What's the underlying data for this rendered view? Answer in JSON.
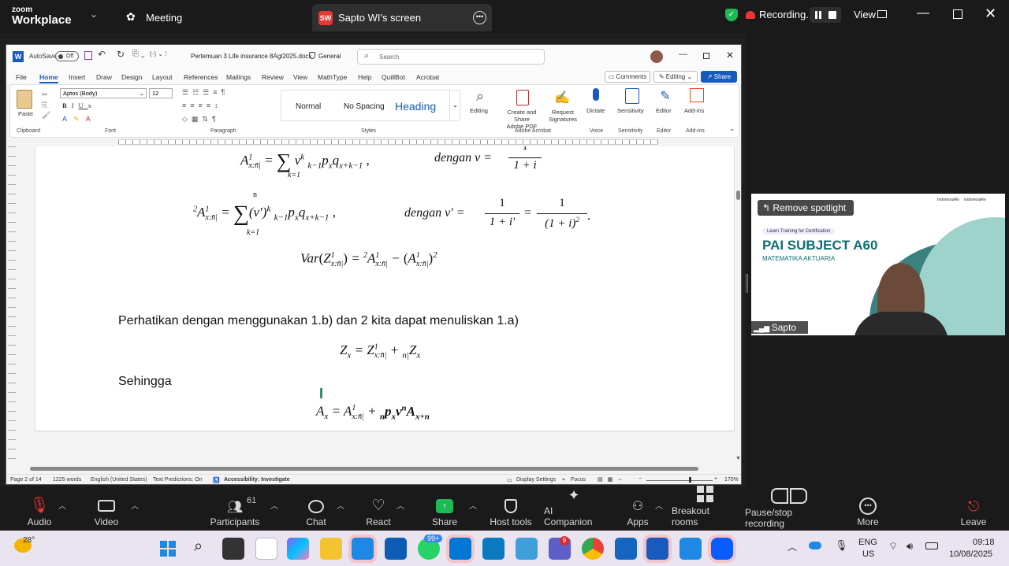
{
  "zoom": {
    "brand_top": "zoom",
    "brand_bottom": "Workplace",
    "meeting_tab": "Meeting",
    "share_tab_badge": "SW",
    "share_tab": "Sapto WI's screen",
    "recording": "Recording...",
    "view": "View"
  },
  "word": {
    "autosave": "AutoSave",
    "autosave_state": "Off",
    "filename": "Pertemuan 3 Life insurance 8Agt2025.docx",
    "sensitivity": "General",
    "search_placeholder": "Search",
    "tabs": [
      "File",
      "Home",
      "Insert",
      "Draw",
      "Design",
      "Layout",
      "References",
      "Mailings",
      "Review",
      "View",
      "MathType",
      "Help",
      "QuillBot",
      "Acrobat"
    ],
    "comments": "Comments",
    "editing": "Editing",
    "share": "Share",
    "font_name": "Aptos (Body)",
    "font_size": "12",
    "styles": {
      "normal": "Normal",
      "nospacing": "No Spacing",
      "heading": "Heading",
      "group": "Styles"
    },
    "groups": {
      "clipboard": "Clipboard",
      "paste": "Paste",
      "font": "Font",
      "paragraph": "Paragraph",
      "adobe": "Adobe Acrobat",
      "voice": "Voice",
      "sensitivity": "Sensitivity",
      "editor": "Editor",
      "addins": "Add-ins"
    },
    "ribbon_right": {
      "editing": "Editing",
      "create_share_1": "Create and Share",
      "create_share_2": "Adobe PDF",
      "request_1": "Request",
      "request_2": "Signatures",
      "dictate": "Dictate",
      "sensitivity": "Sensitivity",
      "editor": "Editor",
      "addins": "Add-ins"
    },
    "doc": {
      "text1": "Perhatikan dengan menggunakan 1.b) dan 2 kita dapat menuliskan 1.a)",
      "text2": "Sehingga"
    },
    "status": {
      "page": "Page 2 of 14",
      "words": "1225 words",
      "lang": "English (United States)",
      "predictions": "Text Predictions: On",
      "accessibility": "Accessibility: Investigate",
      "display": "Display Settings",
      "focus": "Focus",
      "zoom": "170%"
    }
  },
  "video": {
    "remove_spotlight": "Remove spotlight",
    "name": "Sapto WI",
    "slide_kicker": "Learn Training for Certification",
    "slide_title": "PAI SUBJECT A60",
    "slide_sub": "MATEMATIKA AKTUARIA",
    "logo_right": "indonesiaRe",
    "logo_left": "IndonesiaRe"
  },
  "controls": {
    "audio": "Audio",
    "video": "Video",
    "participants": "Participants",
    "participants_count": "61",
    "chat": "Chat",
    "react": "React",
    "share": "Share",
    "host_tools": "Host tools",
    "ai": "AI Companion",
    "apps": "Apps",
    "breakout": "Breakout rooms",
    "record": "Pause/stop recording",
    "more": "More",
    "leave": "Leave"
  },
  "taskbar": {
    "temp": "28°",
    "lang1": "ENG",
    "lang2": "US",
    "time": "09:18",
    "date": "10/08/2025",
    "badge_wa": "99+",
    "badge_teams": "9"
  }
}
